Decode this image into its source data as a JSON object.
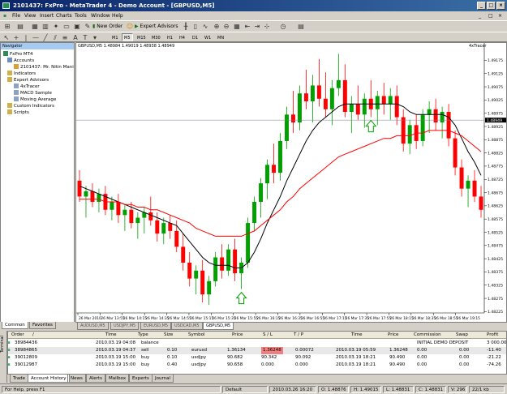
{
  "window": {
    "title": "2101437: FxPro - MetaTrader 4 - Demo Account - [GBPUSD,M5]"
  },
  "menu": [
    "File",
    "View",
    "Insert",
    "Charts",
    "Tools",
    "Window",
    "Help"
  ],
  "toolbar": {
    "new_order": "New Order",
    "expert_advisors": "Expert Advisors",
    "timeframes": [
      "M1",
      "M5",
      "M15",
      "M30",
      "H1",
      "H4",
      "D1",
      "W1",
      "MN"
    ],
    "active_timeframe": "M5",
    "text_tool": "A",
    "label_tool": "T"
  },
  "navigator": {
    "header": "Navigator",
    "items": [
      {
        "label": "FxPro MT4",
        "level": 0
      },
      {
        "label": "Accounts",
        "level": 1
      },
      {
        "label": "2101437: Mr. Nitin Mani",
        "level": 2
      },
      {
        "label": "Indicators",
        "level": 1
      },
      {
        "label": "Expert Advisors",
        "level": 1
      },
      {
        "label": "4xTracer",
        "level": 2
      },
      {
        "label": "MACD Sample",
        "level": 2
      },
      {
        "label": "Moving Average",
        "level": 2
      },
      {
        "label": "Custom Indicators",
        "level": 1
      },
      {
        "label": "Scripts",
        "level": 1
      }
    ],
    "tabs": [
      "Common",
      "Favorites"
    ]
  },
  "chart": {
    "header": "GBPUSD,M5  1.48984 1.49019 1.48938 1.48949",
    "ea_label": "4xTracer",
    "current_price": "1.48949",
    "tabs": [
      "AUDUSD,M5",
      "USDJPY,M5",
      "EURUSD,M5",
      "USDCAD,M5",
      "GBPUSD,M5"
    ],
    "active_tab": "GBPUSD,M5",
    "colors": {
      "bull": "#00a000",
      "bear": "#ff0000",
      "ma_fast": "#000000",
      "ma_slow": "#ff0000",
      "arrow": "#00a000"
    }
  },
  "chart_data": {
    "type": "candlestick",
    "symbol": "GBPUSD",
    "timeframe": "M5",
    "price_axis": [
      "1.49175",
      "1.49125",
      "1.49075",
      "1.49025",
      "1.48975",
      "1.48925",
      "1.48875",
      "1.48825",
      "1.48775",
      "1.48725",
      "1.48675",
      "1.48625",
      "1.48575",
      "1.48525",
      "1.48475",
      "1.48425",
      "1.48375",
      "1.48325",
      "1.48275",
      "1.48225"
    ],
    "ylim": [
      1.4822,
      1.4921
    ],
    "time_axis": [
      "26 Mar 2010",
      "26 Mar 13:55",
      "26 Mar 14:15",
      "26 Mar 14:35",
      "26 Mar 14:55",
      "26 Mar 15:15",
      "26 Mar 15:35",
      "26 Mar 15:55",
      "26 Mar 16:15",
      "26 Mar 16:35",
      "26 Mar 16:55",
      "26 Mar 17:15",
      "26 Mar 17:35",
      "26 Mar 17:55",
      "26 Mar 18:15",
      "26 Mar 18:35",
      "26 Mar 18:55",
      "26 Mar 19:15"
    ],
    "candles": [
      {
        "o": 1.4872,
        "h": 1.4876,
        "l": 1.4864,
        "c": 1.4866
      },
      {
        "o": 1.4866,
        "h": 1.487,
        "l": 1.4858,
        "c": 1.4868
      },
      {
        "o": 1.4868,
        "h": 1.4871,
        "l": 1.4862,
        "c": 1.4864
      },
      {
        "o": 1.4864,
        "h": 1.4869,
        "l": 1.486,
        "c": 1.4867
      },
      {
        "o": 1.4867,
        "h": 1.487,
        "l": 1.4859,
        "c": 1.4861
      },
      {
        "o": 1.4861,
        "h": 1.4866,
        "l": 1.4857,
        "c": 1.4864
      },
      {
        "o": 1.4864,
        "h": 1.4867,
        "l": 1.4856,
        "c": 1.4859
      },
      {
        "o": 1.4859,
        "h": 1.4863,
        "l": 1.4853,
        "c": 1.4861
      },
      {
        "o": 1.4861,
        "h": 1.4864,
        "l": 1.4854,
        "c": 1.4856
      },
      {
        "o": 1.4856,
        "h": 1.486,
        "l": 1.485,
        "c": 1.4858
      },
      {
        "o": 1.4858,
        "h": 1.4862,
        "l": 1.4852,
        "c": 1.486
      },
      {
        "o": 1.486,
        "h": 1.4866,
        "l": 1.4855,
        "c": 1.4857
      },
      {
        "o": 1.4857,
        "h": 1.486,
        "l": 1.4849,
        "c": 1.4852
      },
      {
        "o": 1.4852,
        "h": 1.4858,
        "l": 1.4848,
        "c": 1.4856
      },
      {
        "o": 1.4856,
        "h": 1.4859,
        "l": 1.485,
        "c": 1.4853
      },
      {
        "o": 1.4853,
        "h": 1.4857,
        "l": 1.4845,
        "c": 1.4847
      },
      {
        "o": 1.4847,
        "h": 1.4852,
        "l": 1.4838,
        "c": 1.4841
      },
      {
        "o": 1.4841,
        "h": 1.4845,
        "l": 1.4832,
        "c": 1.4835
      },
      {
        "o": 1.4835,
        "h": 1.484,
        "l": 1.4829,
        "c": 1.4838
      },
      {
        "o": 1.4838,
        "h": 1.4842,
        "l": 1.4826,
        "c": 1.4829
      },
      {
        "o": 1.4829,
        "h": 1.4836,
        "l": 1.4825,
        "c": 1.4834
      },
      {
        "o": 1.4834,
        "h": 1.4845,
        "l": 1.4832,
        "c": 1.4843
      },
      {
        "o": 1.4843,
        "h": 1.4848,
        "l": 1.4835,
        "c": 1.4838
      },
      {
        "o": 1.4838,
        "h": 1.4848,
        "l": 1.4836,
        "c": 1.4846
      },
      {
        "o": 1.4846,
        "h": 1.485,
        "l": 1.4834,
        "c": 1.4837
      },
      {
        "o": 1.4837,
        "h": 1.4843,
        "l": 1.4831,
        "c": 1.4841
      },
      {
        "o": 1.4841,
        "h": 1.4858,
        "l": 1.4839,
        "c": 1.4856
      },
      {
        "o": 1.4856,
        "h": 1.4866,
        "l": 1.4853,
        "c": 1.4864
      },
      {
        "o": 1.4864,
        "h": 1.4873,
        "l": 1.4858,
        "c": 1.4871
      },
      {
        "o": 1.4871,
        "h": 1.488,
        "l": 1.4865,
        "c": 1.4878
      },
      {
        "o": 1.4878,
        "h": 1.4886,
        "l": 1.4871,
        "c": 1.4875
      },
      {
        "o": 1.4875,
        "h": 1.489,
        "l": 1.4872,
        "c": 1.4887
      },
      {
        "o": 1.4887,
        "h": 1.49,
        "l": 1.4884,
        "c": 1.4897
      },
      {
        "o": 1.4897,
        "h": 1.4906,
        "l": 1.489,
        "c": 1.4894
      },
      {
        "o": 1.4894,
        "h": 1.4908,
        "l": 1.4891,
        "c": 1.4905
      },
      {
        "o": 1.4905,
        "h": 1.4914,
        "l": 1.4899,
        "c": 1.4902
      },
      {
        "o": 1.4902,
        "h": 1.4912,
        "l": 1.4894,
        "c": 1.4908
      },
      {
        "o": 1.4908,
        "h": 1.4918,
        "l": 1.49,
        "c": 1.4903
      },
      {
        "o": 1.4903,
        "h": 1.4913,
        "l": 1.4896,
        "c": 1.4899
      },
      {
        "o": 1.4899,
        "h": 1.491,
        "l": 1.4893,
        "c": 1.4907
      },
      {
        "o": 1.4907,
        "h": 1.492,
        "l": 1.4904,
        "c": 1.491
      },
      {
        "o": 1.491,
        "h": 1.4916,
        "l": 1.4896,
        "c": 1.4898
      },
      {
        "o": 1.4898,
        "h": 1.4904,
        "l": 1.489,
        "c": 1.4901
      },
      {
        "o": 1.4901,
        "h": 1.4908,
        "l": 1.4895,
        "c": 1.4897
      },
      {
        "o": 1.4897,
        "h": 1.4905,
        "l": 1.4892,
        "c": 1.4903
      },
      {
        "o": 1.4903,
        "h": 1.491,
        "l": 1.4896,
        "c": 1.4899
      },
      {
        "o": 1.4899,
        "h": 1.4906,
        "l": 1.4893,
        "c": 1.4904
      },
      {
        "o": 1.4904,
        "h": 1.4909,
        "l": 1.4897,
        "c": 1.4901
      },
      {
        "o": 1.4901,
        "h": 1.4907,
        "l": 1.4895,
        "c": 1.4904
      },
      {
        "o": 1.4904,
        "h": 1.4908,
        "l": 1.4893,
        "c": 1.4896
      },
      {
        "o": 1.4896,
        "h": 1.4899,
        "l": 1.4883,
        "c": 1.4886
      },
      {
        "o": 1.4886,
        "h": 1.4895,
        "l": 1.4882,
        "c": 1.4893
      },
      {
        "o": 1.4893,
        "h": 1.4897,
        "l": 1.4884,
        "c": 1.4887
      },
      {
        "o": 1.4887,
        "h": 1.4899,
        "l": 1.4885,
        "c": 1.4897
      },
      {
        "o": 1.4897,
        "h": 1.4902,
        "l": 1.489,
        "c": 1.4899
      },
      {
        "o": 1.4899,
        "h": 1.4903,
        "l": 1.4891,
        "c": 1.4894
      },
      {
        "o": 1.4894,
        "h": 1.49,
        "l": 1.4888,
        "c": 1.4898
      },
      {
        "o": 1.4898,
        "h": 1.4901,
        "l": 1.4885,
        "c": 1.4888
      },
      {
        "o": 1.4888,
        "h": 1.4891,
        "l": 1.4874,
        "c": 1.4877
      },
      {
        "o": 1.4877,
        "h": 1.488,
        "l": 1.4866,
        "c": 1.4869
      },
      {
        "o": 1.4869,
        "h": 1.4874,
        "l": 1.4862,
        "c": 1.4872
      },
      {
        "o": 1.4872,
        "h": 1.4876,
        "l": 1.4864,
        "c": 1.4866
      },
      {
        "o": 1.4866,
        "h": 1.487,
        "l": 1.4858,
        "c": 1.4861
      }
    ],
    "series": [
      {
        "name": "ma_fast",
        "values": [
          1.487,
          1.4869,
          1.4868,
          1.4867,
          1.4866,
          1.4865,
          1.4864,
          1.4863,
          1.4862,
          1.4861,
          1.486,
          1.4859,
          1.4858,
          1.4857,
          1.4856,
          1.4855,
          1.4852,
          1.4849,
          1.4846,
          1.4843,
          1.4841,
          1.484,
          1.484,
          1.484,
          1.4839,
          1.4839,
          1.4841,
          1.4845,
          1.485,
          1.4856,
          1.4861,
          1.4866,
          1.4872,
          1.4877,
          1.4882,
          1.4887,
          1.4891,
          1.4894,
          1.4896,
          1.4898,
          1.49,
          1.4901,
          1.4901,
          1.4901,
          1.4901,
          1.4901,
          1.4901,
          1.4901,
          1.4901,
          1.4901,
          1.49,
          1.4898,
          1.4897,
          1.4897,
          1.4897,
          1.4897,
          1.4897,
          1.4896,
          1.4893,
          1.4888,
          1.4883,
          1.4879,
          1.4874
        ]
      },
      {
        "name": "ma_slow",
        "values": [
          1.4865,
          1.4865,
          1.4865,
          1.4865,
          1.4864,
          1.4864,
          1.4864,
          1.4863,
          1.4863,
          1.4862,
          1.4862,
          1.4861,
          1.4861,
          1.486,
          1.4859,
          1.4858,
          1.4857,
          1.4856,
          1.4854,
          1.4853,
          1.4852,
          1.4851,
          1.4851,
          1.4851,
          1.4851,
          1.4851,
          1.4852,
          1.4853,
          1.4855,
          1.4857,
          1.4859,
          1.4861,
          1.4864,
          1.4866,
          1.4869,
          1.4871,
          1.4873,
          1.4875,
          1.4877,
          1.4879,
          1.4881,
          1.4882,
          1.4883,
          1.4884,
          1.4885,
          1.4886,
          1.4887,
          1.4888,
          1.4888,
          1.4889,
          1.4889,
          1.4889,
          1.489,
          1.489,
          1.4891,
          1.4891,
          1.4891,
          1.4891,
          1.489,
          1.4889,
          1.4887,
          1.4885,
          1.4883
        ]
      }
    ],
    "signals": [
      {
        "type": "buy",
        "index": 25
      },
      {
        "type": "buy",
        "index": 45
      }
    ]
  },
  "terminal": {
    "side_label": "Terminal",
    "columns": [
      "Order",
      "/",
      "Time",
      "Type",
      "Size",
      "Symbol",
      "Price",
      "S / L",
      "T / P",
      "",
      "Time",
      "Price",
      "Commission",
      "Swap",
      "Profit"
    ],
    "rows": [
      {
        "order": "38984436",
        "time": "2010.03.19 04:08",
        "type": "balance",
        "size": "",
        "symbol": "",
        "price": "",
        "sl": "",
        "tp": "",
        "close_time": "",
        "close_price": "",
        "commission": "INITIAL DEMO DEPOSIT",
        "swap": "",
        "profit": "3 000.00"
      },
      {
        "order": "38984865",
        "time": "2010.03.19 04:37",
        "type": "sell",
        "size": "0.10",
        "symbol": "eurusd",
        "price": "1.36134",
        "sl": "1.36248",
        "tp": "0.00072",
        "close_time": "2010.03.19 05:59",
        "close_price": "1.36248",
        "commission": "0.00",
        "swap": "0.00",
        "profit": "-11.40"
      },
      {
        "order": "39012809",
        "time": "2010.03.19 15:00",
        "type": "buy",
        "size": "0.10",
        "symbol": "usdjpy",
        "price": "90.682",
        "sl": "90.342",
        "tp": "90.092",
        "close_time": "2010.03.19 18:21",
        "close_price": "90.490",
        "commission": "0.00",
        "swap": "0.00",
        "profit": "-21.22"
      },
      {
        "order": "39012987",
        "time": "2010.03.19 15:00",
        "type": "buy",
        "size": "0.40",
        "symbol": "usdjpy",
        "price": "90.658",
        "sl": "0.000",
        "tp": "0.000",
        "close_time": "2010.03.19 18:21",
        "close_price": "90.490",
        "commission": "0.00",
        "swap": "0.00",
        "profit": "-74.26"
      }
    ],
    "tabs": [
      "Trade",
      "Account History",
      "News",
      "Alerts",
      "Mailbox",
      "Experts",
      "Journal"
    ],
    "active_tab": "Account History"
  },
  "status": {
    "help": "For Help, press F1",
    "profile": "Default",
    "datetime": "2010.03.26 16:20",
    "open": "O: 1.48876",
    "high": "H: 1.49015",
    "low": "L: 1.48831",
    "close": "C: 1.48831",
    "volume": "V: 296",
    "traffic": "22/1 kb"
  }
}
